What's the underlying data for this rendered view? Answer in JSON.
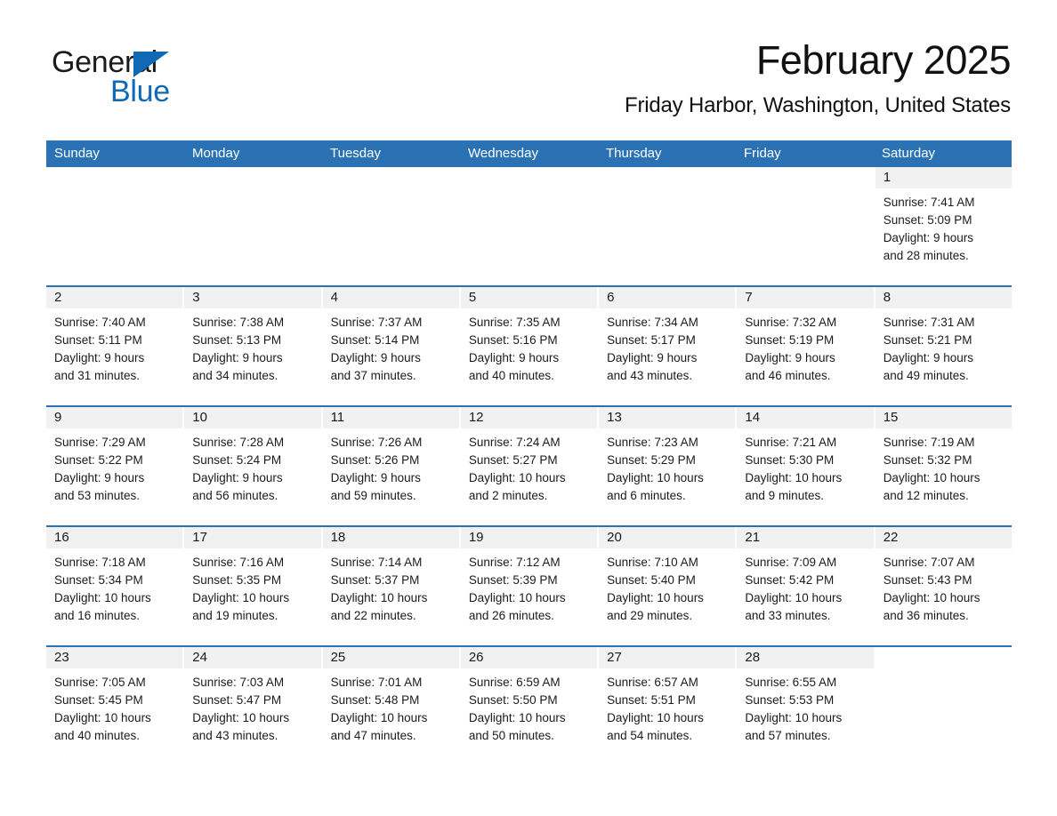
{
  "logo": {
    "word_one": "General",
    "word_two": "Blue",
    "triangle_color": "#1069b4",
    "icon": "triangle-icon"
  },
  "header": {
    "title": "February 2025",
    "subtitle": "Friday Harbor, Washington, United States"
  },
  "colors": {
    "header_blue": "#2b72b5",
    "daynum_gray": "#f1f1f1",
    "text": "#1b1b1b",
    "logo_blue": "#1069b4"
  },
  "weekday_headers": [
    "Sunday",
    "Monday",
    "Tuesday",
    "Wednesday",
    "Thursday",
    "Friday",
    "Saturday"
  ],
  "weeks": [
    [
      {
        "blank": true,
        "day": "",
        "sunrise": "",
        "sunset": "",
        "daylight_line1": "",
        "daylight_line2": ""
      },
      {
        "blank": true,
        "day": "",
        "sunrise": "",
        "sunset": "",
        "daylight_line1": "",
        "daylight_line2": ""
      },
      {
        "blank": true,
        "day": "",
        "sunrise": "",
        "sunset": "",
        "daylight_line1": "",
        "daylight_line2": ""
      },
      {
        "blank": true,
        "day": "",
        "sunrise": "",
        "sunset": "",
        "daylight_line1": "",
        "daylight_line2": ""
      },
      {
        "blank": true,
        "day": "",
        "sunrise": "",
        "sunset": "",
        "daylight_line1": "",
        "daylight_line2": ""
      },
      {
        "blank": true,
        "day": "",
        "sunrise": "",
        "sunset": "",
        "daylight_line1": "",
        "daylight_line2": ""
      },
      {
        "blank": false,
        "day": "1",
        "sunrise": "Sunrise: 7:41 AM",
        "sunset": "Sunset: 5:09 PM",
        "daylight_line1": "Daylight: 9 hours",
        "daylight_line2": "and 28 minutes."
      }
    ],
    [
      {
        "blank": false,
        "day": "2",
        "sunrise": "Sunrise: 7:40 AM",
        "sunset": "Sunset: 5:11 PM",
        "daylight_line1": "Daylight: 9 hours",
        "daylight_line2": "and 31 minutes."
      },
      {
        "blank": false,
        "day": "3",
        "sunrise": "Sunrise: 7:38 AM",
        "sunset": "Sunset: 5:13 PM",
        "daylight_line1": "Daylight: 9 hours",
        "daylight_line2": "and 34 minutes."
      },
      {
        "blank": false,
        "day": "4",
        "sunrise": "Sunrise: 7:37 AM",
        "sunset": "Sunset: 5:14 PM",
        "daylight_line1": "Daylight: 9 hours",
        "daylight_line2": "and 37 minutes."
      },
      {
        "blank": false,
        "day": "5",
        "sunrise": "Sunrise: 7:35 AM",
        "sunset": "Sunset: 5:16 PM",
        "daylight_line1": "Daylight: 9 hours",
        "daylight_line2": "and 40 minutes."
      },
      {
        "blank": false,
        "day": "6",
        "sunrise": "Sunrise: 7:34 AM",
        "sunset": "Sunset: 5:17 PM",
        "daylight_line1": "Daylight: 9 hours",
        "daylight_line2": "and 43 minutes."
      },
      {
        "blank": false,
        "day": "7",
        "sunrise": "Sunrise: 7:32 AM",
        "sunset": "Sunset: 5:19 PM",
        "daylight_line1": "Daylight: 9 hours",
        "daylight_line2": "and 46 minutes."
      },
      {
        "blank": false,
        "day": "8",
        "sunrise": "Sunrise: 7:31 AM",
        "sunset": "Sunset: 5:21 PM",
        "daylight_line1": "Daylight: 9 hours",
        "daylight_line2": "and 49 minutes."
      }
    ],
    [
      {
        "blank": false,
        "day": "9",
        "sunrise": "Sunrise: 7:29 AM",
        "sunset": "Sunset: 5:22 PM",
        "daylight_line1": "Daylight: 9 hours",
        "daylight_line2": "and 53 minutes."
      },
      {
        "blank": false,
        "day": "10",
        "sunrise": "Sunrise: 7:28 AM",
        "sunset": "Sunset: 5:24 PM",
        "daylight_line1": "Daylight: 9 hours",
        "daylight_line2": "and 56 minutes."
      },
      {
        "blank": false,
        "day": "11",
        "sunrise": "Sunrise: 7:26 AM",
        "sunset": "Sunset: 5:26 PM",
        "daylight_line1": "Daylight: 9 hours",
        "daylight_line2": "and 59 minutes."
      },
      {
        "blank": false,
        "day": "12",
        "sunrise": "Sunrise: 7:24 AM",
        "sunset": "Sunset: 5:27 PM",
        "daylight_line1": "Daylight: 10 hours",
        "daylight_line2": "and 2 minutes."
      },
      {
        "blank": false,
        "day": "13",
        "sunrise": "Sunrise: 7:23 AM",
        "sunset": "Sunset: 5:29 PM",
        "daylight_line1": "Daylight: 10 hours",
        "daylight_line2": "and 6 minutes."
      },
      {
        "blank": false,
        "day": "14",
        "sunrise": "Sunrise: 7:21 AM",
        "sunset": "Sunset: 5:30 PM",
        "daylight_line1": "Daylight: 10 hours",
        "daylight_line2": "and 9 minutes."
      },
      {
        "blank": false,
        "day": "15",
        "sunrise": "Sunrise: 7:19 AM",
        "sunset": "Sunset: 5:32 PM",
        "daylight_line1": "Daylight: 10 hours",
        "daylight_line2": "and 12 minutes."
      }
    ],
    [
      {
        "blank": false,
        "day": "16",
        "sunrise": "Sunrise: 7:18 AM",
        "sunset": "Sunset: 5:34 PM",
        "daylight_line1": "Daylight: 10 hours",
        "daylight_line2": "and 16 minutes."
      },
      {
        "blank": false,
        "day": "17",
        "sunrise": "Sunrise: 7:16 AM",
        "sunset": "Sunset: 5:35 PM",
        "daylight_line1": "Daylight: 10 hours",
        "daylight_line2": "and 19 minutes."
      },
      {
        "blank": false,
        "day": "18",
        "sunrise": "Sunrise: 7:14 AM",
        "sunset": "Sunset: 5:37 PM",
        "daylight_line1": "Daylight: 10 hours",
        "daylight_line2": "and 22 minutes."
      },
      {
        "blank": false,
        "day": "19",
        "sunrise": "Sunrise: 7:12 AM",
        "sunset": "Sunset: 5:39 PM",
        "daylight_line1": "Daylight: 10 hours",
        "daylight_line2": "and 26 minutes."
      },
      {
        "blank": false,
        "day": "20",
        "sunrise": "Sunrise: 7:10 AM",
        "sunset": "Sunset: 5:40 PM",
        "daylight_line1": "Daylight: 10 hours",
        "daylight_line2": "and 29 minutes."
      },
      {
        "blank": false,
        "day": "21",
        "sunrise": "Sunrise: 7:09 AM",
        "sunset": "Sunset: 5:42 PM",
        "daylight_line1": "Daylight: 10 hours",
        "daylight_line2": "and 33 minutes."
      },
      {
        "blank": false,
        "day": "22",
        "sunrise": "Sunrise: 7:07 AM",
        "sunset": "Sunset: 5:43 PM",
        "daylight_line1": "Daylight: 10 hours",
        "daylight_line2": "and 36 minutes."
      }
    ],
    [
      {
        "blank": false,
        "day": "23",
        "sunrise": "Sunrise: 7:05 AM",
        "sunset": "Sunset: 5:45 PM",
        "daylight_line1": "Daylight: 10 hours",
        "daylight_line2": "and 40 minutes."
      },
      {
        "blank": false,
        "day": "24",
        "sunrise": "Sunrise: 7:03 AM",
        "sunset": "Sunset: 5:47 PM",
        "daylight_line1": "Daylight: 10 hours",
        "daylight_line2": "and 43 minutes."
      },
      {
        "blank": false,
        "day": "25",
        "sunrise": "Sunrise: 7:01 AM",
        "sunset": "Sunset: 5:48 PM",
        "daylight_line1": "Daylight: 10 hours",
        "daylight_line2": "and 47 minutes."
      },
      {
        "blank": false,
        "day": "26",
        "sunrise": "Sunrise: 6:59 AM",
        "sunset": "Sunset: 5:50 PM",
        "daylight_line1": "Daylight: 10 hours",
        "daylight_line2": "and 50 minutes."
      },
      {
        "blank": false,
        "day": "27",
        "sunrise": "Sunrise: 6:57 AM",
        "sunset": "Sunset: 5:51 PM",
        "daylight_line1": "Daylight: 10 hours",
        "daylight_line2": "and 54 minutes."
      },
      {
        "blank": false,
        "day": "28",
        "sunrise": "Sunrise: 6:55 AM",
        "sunset": "Sunset: 5:53 PM",
        "daylight_line1": "Daylight: 10 hours",
        "daylight_line2": "and 57 minutes."
      },
      {
        "blank": true,
        "day": "",
        "sunrise": "",
        "sunset": "",
        "daylight_line1": "",
        "daylight_line2": ""
      }
    ]
  ]
}
